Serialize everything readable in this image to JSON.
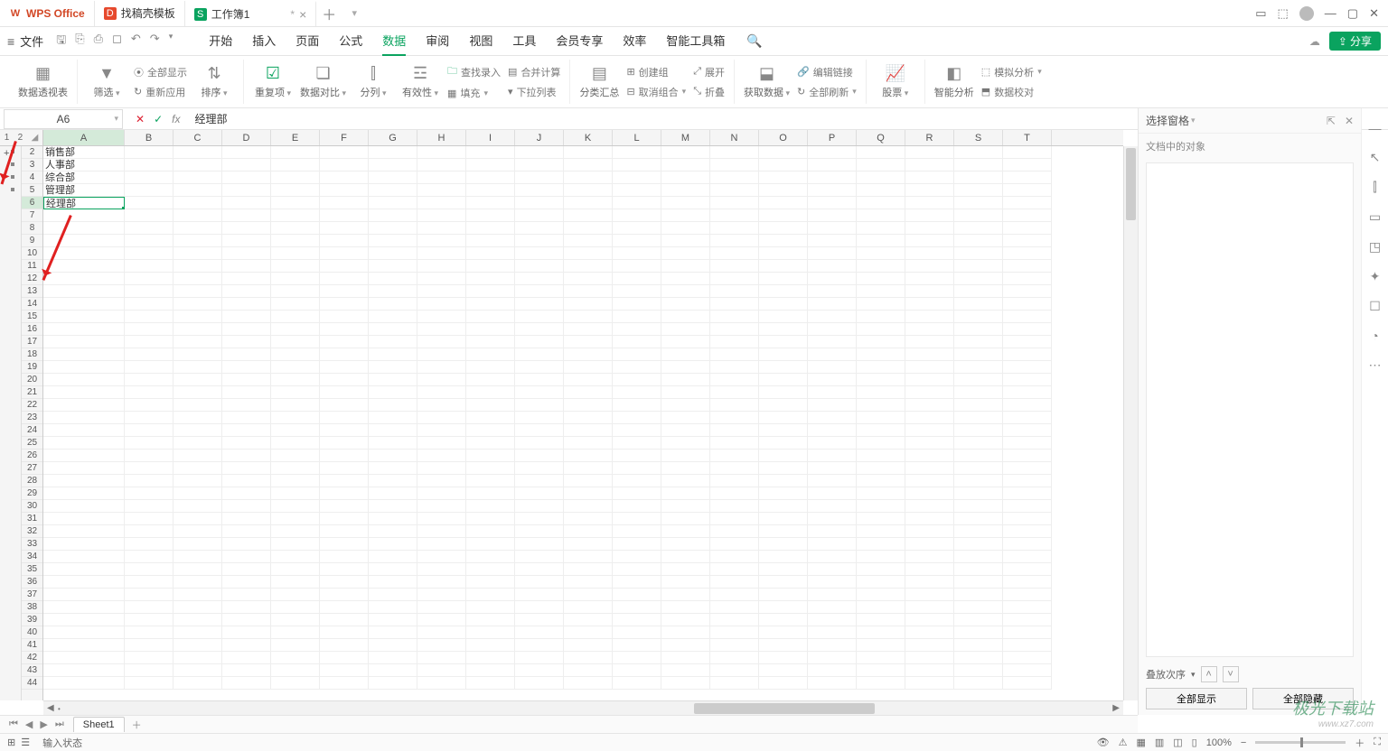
{
  "titlebar": {
    "app_name": "WPS Office",
    "tabs": [
      {
        "icon": "D",
        "label": "找稿壳模板",
        "close": true
      },
      {
        "icon": "S",
        "label": "工作簿1",
        "close": true,
        "dirty": "*"
      }
    ],
    "win": {
      "phone": "⎘",
      "cube": "⬚",
      "avatar": "◯",
      "min": "—",
      "max": "▢",
      "close": "✕"
    }
  },
  "menubar": {
    "file": "文件",
    "tabs": [
      "开始",
      "插入",
      "页面",
      "公式",
      "数据",
      "审阅",
      "视图",
      "工具",
      "会员专享",
      "效率",
      "智能工具箱"
    ],
    "active": "数据",
    "share": "分享"
  },
  "ribbon": {
    "g1": {
      "pivot": "数据透视表"
    },
    "g2": {
      "filter": "筛选",
      "showall": "全部显示",
      "reapply": "重新应用",
      "sort": "排序"
    },
    "g3": {
      "dup": "重复项",
      "compare": "数据对比",
      "split": "分列",
      "valid": "有效性",
      "fill": "填充",
      "dropdown": "下拉列表",
      "lookup": "查找录入",
      "consol": "合并计算"
    },
    "g4": {
      "subtotal": "分类汇总",
      "group": "创建组",
      "ungroup": "取消组合",
      "expand": "展开",
      "collapse": "折叠"
    },
    "g5": {
      "getdata": "获取数据",
      "editlink": "编辑链接",
      "refreshall": "全部刷新"
    },
    "g6": {
      "stock": "股票"
    },
    "g7": {
      "smart": "智能分析",
      "sim": "模拟分析",
      "audit": "数据校对"
    }
  },
  "formula": {
    "cellref": "A6",
    "value": "经理部"
  },
  "outline": {
    "levels": [
      "1",
      "2"
    ],
    "plus": "+"
  },
  "columns": [
    "A",
    "B",
    "C",
    "D",
    "E",
    "F",
    "G",
    "H",
    "I",
    "J",
    "K",
    "L",
    "M",
    "N",
    "O",
    "P",
    "Q",
    "R",
    "S",
    "T"
  ],
  "rows_visible": [
    2,
    3,
    4,
    5,
    6,
    7,
    8,
    9,
    10,
    11,
    12,
    13,
    14,
    15,
    16,
    17,
    18,
    19,
    20,
    21,
    22,
    23,
    24,
    25,
    26,
    27,
    28,
    29,
    30,
    31,
    32,
    33,
    34,
    35,
    36,
    37,
    38,
    39,
    40,
    41,
    42,
    43,
    44
  ],
  "active_row": 6,
  "cells": {
    "A2": "销售部",
    "A3": "人事部",
    "A4": "综合部",
    "A5": "管理部",
    "A6": "经理部"
  },
  "sheettabs": {
    "sheet": "Sheet1"
  },
  "rightpane": {
    "title": "选择窗格",
    "sub": "文档中的对象",
    "order": "叠放次序",
    "show_all": "全部显示",
    "hide_all": "全部隐藏"
  },
  "status": {
    "mode": "输入状态",
    "zoom": "100%"
  },
  "watermark": {
    "big": "极光下载站",
    "small": "www.xz7.com"
  }
}
